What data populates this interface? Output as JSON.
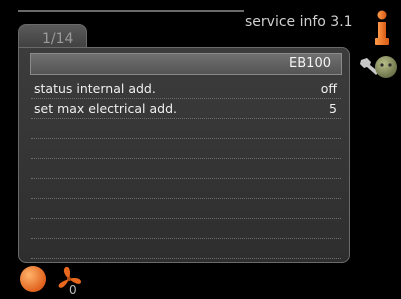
{
  "title": "service info 3.1",
  "tab": {
    "page": "1/14"
  },
  "header": {
    "label": "EB100"
  },
  "rows": [
    {
      "label": "status internal add.",
      "value": "off"
    },
    {
      "label": "set max electrical add.",
      "value": "5"
    },
    {
      "label": "",
      "value": ""
    },
    {
      "label": "",
      "value": ""
    },
    {
      "label": "",
      "value": ""
    },
    {
      "label": "",
      "value": ""
    },
    {
      "label": "",
      "value": ""
    },
    {
      "label": "",
      "value": ""
    },
    {
      "label": "",
      "value": ""
    },
    {
      "label": "",
      "value": ""
    }
  ],
  "status": {
    "fan_value": "0"
  },
  "icons": [
    "info-alarm-icon",
    "service-tool-icon",
    "sun-icon",
    "fan-icon"
  ],
  "colors": {
    "accent_orange": "#e8691e",
    "panel": "#3a3a3a",
    "header_bar": "#626262"
  }
}
